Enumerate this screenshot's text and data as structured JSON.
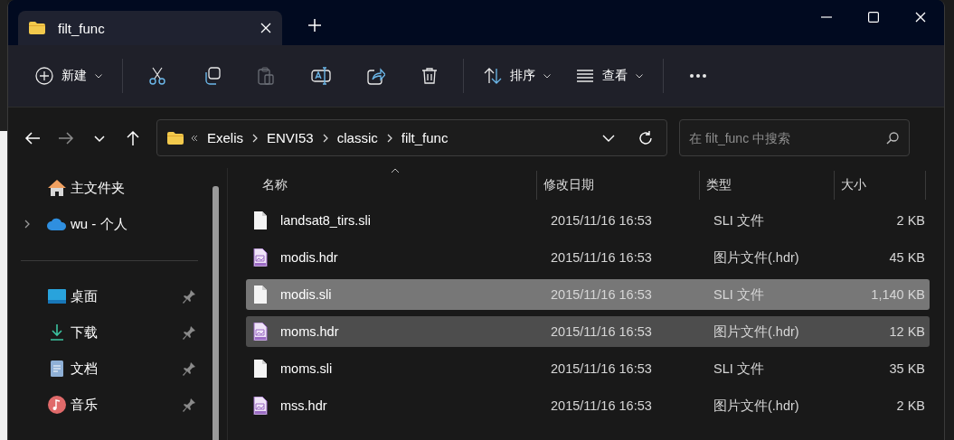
{
  "tabs": [
    {
      "label": "filt_func",
      "selected": true
    }
  ],
  "toolbar": [
    {
      "kind": "new",
      "label": "新建",
      "disabled": false
    },
    {
      "kind": "cut",
      "disabled": false
    },
    {
      "kind": "copy",
      "disabled": false
    },
    {
      "kind": "paste",
      "disabled": true
    },
    {
      "kind": "rename",
      "disabled": false
    },
    {
      "kind": "share",
      "disabled": false
    },
    {
      "kind": "delete",
      "disabled": false
    },
    {
      "kind": "sort",
      "label": "排序",
      "disabled": false
    },
    {
      "kind": "view",
      "label": "查看",
      "disabled": false
    },
    {
      "kind": "more",
      "disabled": false
    }
  ],
  "navigation": {
    "back_disabled": false,
    "forward_disabled": true
  },
  "address_bar": {
    "breadcrumbs": [
      "Exelis",
      "ENVI53",
      "classic",
      "filt_func"
    ]
  },
  "search": {
    "placeholder": "在 filt_func 中搜索"
  },
  "sidebar": {
    "sections": [
      {
        "items": [
          {
            "kind": "home",
            "label": "主文件夹",
            "expandable": false,
            "pinned": false
          },
          {
            "kind": "cloud",
            "label": "wu - 个人",
            "expandable": true,
            "pinned": false
          }
        ]
      },
      {
        "items": [
          {
            "kind": "desktop",
            "label": "桌面",
            "expandable": false,
            "pinned": true
          },
          {
            "kind": "download",
            "label": "下载",
            "expandable": false,
            "pinned": true
          },
          {
            "kind": "documents",
            "label": "文档",
            "expandable": false,
            "pinned": true
          },
          {
            "kind": "music",
            "label": "音乐",
            "expandable": false,
            "pinned": true
          }
        ]
      }
    ]
  },
  "table": {
    "columns": [
      {
        "label": "名称",
        "sorted": true
      },
      {
        "label": "修改日期",
        "sorted": false
      },
      {
        "label": "类型",
        "sorted": false
      },
      {
        "label": "大小",
        "sorted": false
      }
    ],
    "rows": [
      {
        "kind": "sli",
        "name": "landsat8_tirs.sli",
        "modified": "2015/11/16 16:53",
        "type": "SLI 文件",
        "size": "2 KB",
        "selected": false,
        "hovered": false
      },
      {
        "kind": "hdr",
        "name": "modis.hdr",
        "modified": "2015/11/16 16:53",
        "type": "图片文件(.hdr)",
        "size": "45 KB",
        "selected": false,
        "hovered": false
      },
      {
        "kind": "sli",
        "name": "modis.sli",
        "modified": "2015/11/16 16:53",
        "type": "SLI 文件",
        "size": "1,140 KB",
        "selected": true,
        "hovered": false
      },
      {
        "kind": "hdr",
        "name": "moms.hdr",
        "modified": "2015/11/16 16:53",
        "type": "图片文件(.hdr)",
        "size": "12 KB",
        "selected": false,
        "hovered": true
      },
      {
        "kind": "sli",
        "name": "moms.sli",
        "modified": "2015/11/16 16:53",
        "type": "SLI 文件",
        "size": "35 KB",
        "selected": false,
        "hovered": false
      },
      {
        "kind": "hdr",
        "name": "mss.hdr",
        "modified": "2015/11/16 16:53",
        "type": "图片文件(.hdr)",
        "size": "2 KB",
        "selected": false,
        "hovered": false
      }
    ]
  }
}
